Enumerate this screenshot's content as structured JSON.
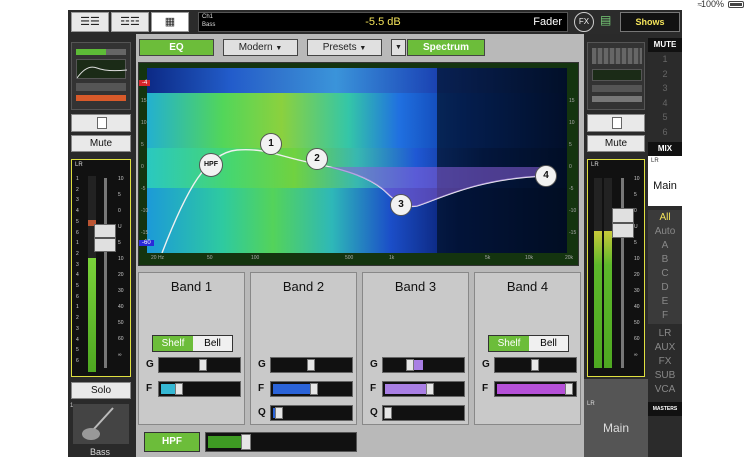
{
  "status": {
    "battery": "100%"
  },
  "topbar": {
    "channel_num": "Ch1",
    "channel_name": "Bass",
    "db": "-5.5 dB",
    "mode": "Fader",
    "fx": "FX",
    "shows": "Shows"
  },
  "eq_toolbar": {
    "eq": "EQ",
    "modern": "Modern",
    "presets": "Presets",
    "spectrum": "Spectrum"
  },
  "graph": {
    "top_tag": "-4",
    "bottom_tag": "-60",
    "x_ticks": [
      "20 Hz",
      "50",
      "100",
      "500",
      "1k",
      "5k",
      "10k",
      "20k"
    ],
    "y_ticks_left": [
      "15",
      "10",
      "5",
      "0",
      "-5",
      "-10",
      "-15"
    ],
    "y_ticks_right": [
      "15",
      "10",
      "5",
      "0",
      "-5",
      "-10",
      "-15"
    ],
    "nodes": [
      "HPF",
      "1",
      "2",
      "3",
      "4"
    ]
  },
  "bands": [
    {
      "title": "Band 1",
      "shelf": "Shelf",
      "bell": "Bell",
      "mode": "shelf",
      "g_label": "G",
      "f_label": "F",
      "g": 0.57,
      "f": 0.22,
      "color": "#35b8d4"
    },
    {
      "title": "Band 2",
      "g_label": "G",
      "f_label": "F",
      "q_label": "Q",
      "g": 0.5,
      "f": 0.55,
      "q": 0.06,
      "color": "#2a63d8"
    },
    {
      "title": "Band 3",
      "g_label": "G",
      "f_label": "F",
      "q_label": "Q",
      "g": 0.32,
      "f": 0.6,
      "q": 0.02,
      "color": "#a97fe4"
    },
    {
      "title": "Band 4",
      "shelf": "Shelf",
      "bell": "Bell",
      "mode": "shelf",
      "g_label": "G",
      "f_label": "F",
      "g": 0.5,
      "f": 0.98,
      "color": "#b550d8"
    }
  ],
  "hpf": {
    "label": "HPF",
    "value": 0.25
  },
  "left_strip": {
    "mute": "Mute",
    "solo": "Solo",
    "lr": "LR",
    "channel_number": "1",
    "name": "Bass",
    "fader_scale": [
      "10",
      "5",
      "0",
      "U",
      "5",
      "10",
      "20",
      "30",
      "40",
      "50",
      "60",
      "∞"
    ],
    "meter_labels": [
      "1",
      "2",
      "3",
      "4",
      "5",
      "6",
      "1",
      "2",
      "3",
      "4",
      "5",
      "6",
      "1",
      "2",
      "3",
      "4",
      "5",
      "6"
    ]
  },
  "right_strip": {
    "mute": "Mute",
    "lr": "LR",
    "main_label": "Main",
    "lr_bottom": "LR"
  },
  "right_col": {
    "mute_header": "MUTE",
    "mute_nums": [
      "1",
      "2",
      "3",
      "4",
      "5",
      "6"
    ],
    "mix_header": "MIX",
    "lr_small": "LR",
    "main": "Main",
    "filters": [
      "All",
      "Auto",
      "A",
      "B",
      "C",
      "D",
      "E",
      "F"
    ],
    "outputs": [
      "LR",
      "AUX",
      "FX",
      "SUB",
      "VCA"
    ],
    "masters": "MASTERS"
  }
}
